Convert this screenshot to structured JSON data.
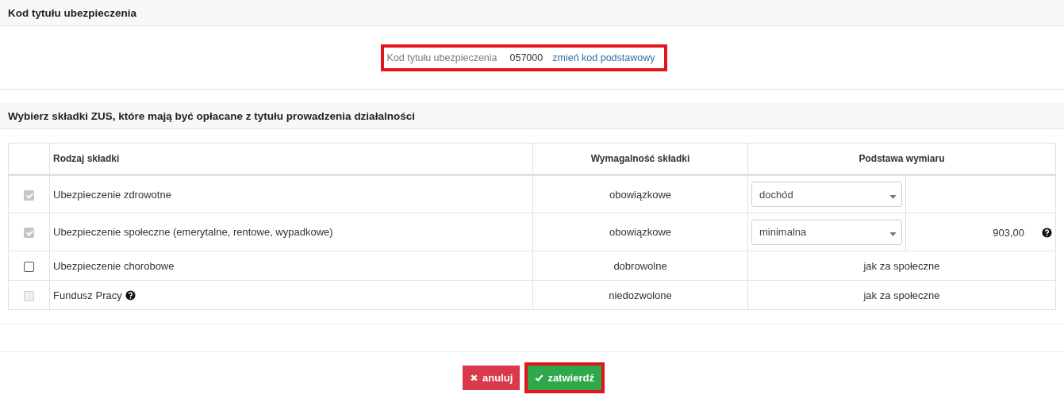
{
  "section_1": {
    "title": "Kod tytułu ubezpieczenia",
    "code_label": "Kod tytułu ubezpieczenia",
    "code_value": "057000",
    "change_link": "zmień kod podstawowy",
    "highlighted": true
  },
  "section_2": {
    "title": "Wybierz składki ZUS, które mają być opłacane z tytułu prowadzenia działalności"
  },
  "table": {
    "columns": [
      "Rodzaj składki",
      "Wymagalność składki",
      "Podstawa wymiaru"
    ],
    "rows": [
      {
        "name": "Ubezpieczenie zdrowotne",
        "checked": true,
        "disabled": true,
        "help": false,
        "requirement": "obowiązkowe",
        "kind": "select",
        "basis": "dochód"
      },
      {
        "name": "Ubezpieczenie społeczne (emerytalne, rentowe, wypadkowe)",
        "checked": true,
        "disabled": true,
        "help": false,
        "requirement": "obowiązkowe",
        "kind": "select",
        "basis": "minimalna",
        "amount": "903,00",
        "amount_help": true
      },
      {
        "name": "Ubezpieczenie chorobowe",
        "checked": false,
        "disabled": false,
        "help": false,
        "requirement": "dobrowolne",
        "kind": "text",
        "basis": "jak za społeczne"
      },
      {
        "name": "Fundusz Pracy",
        "checked": false,
        "disabled": true,
        "help": true,
        "requirement": "niedozwolone",
        "kind": "text",
        "basis": "jak za społeczne"
      }
    ]
  },
  "buttons": [
    {
      "label": "anuluj",
      "kind": "cancel",
      "highlighted": false
    },
    {
      "label": "zatwierdź",
      "kind": "confirm",
      "highlighted": true
    }
  ]
}
